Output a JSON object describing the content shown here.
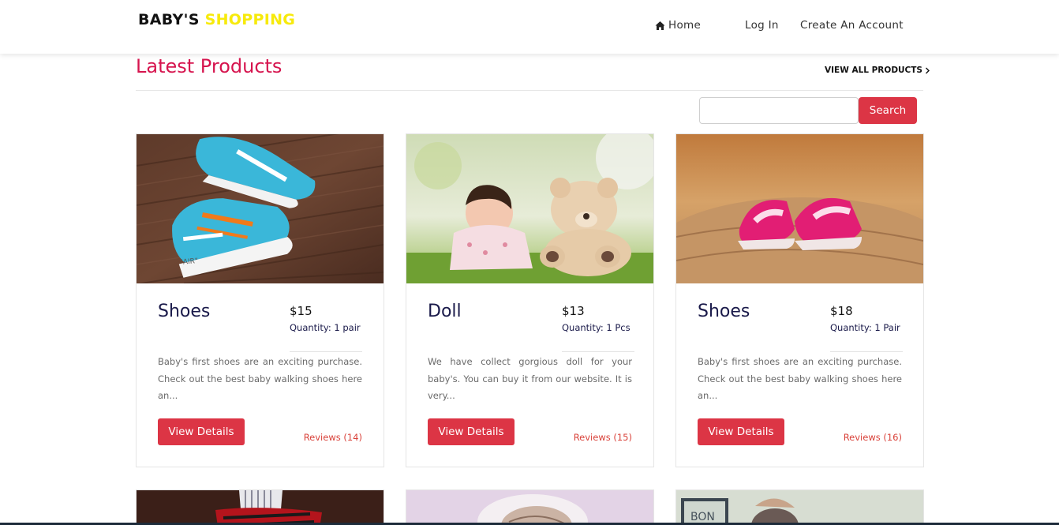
{
  "brand": {
    "part1": "BABY'S",
    "part2": "SHOPPING"
  },
  "nav": {
    "home": "Home",
    "login": "Log In",
    "create": "Create An Account"
  },
  "section": {
    "title": "Latest Products",
    "view_all": "VIEW ALL PRODUCTS"
  },
  "search": {
    "button": "Search",
    "value": ""
  },
  "products": [
    {
      "name": "Shoes",
      "price": "$15",
      "quantity": "Quantity: 1 pair",
      "description": "Baby's first shoes are an exciting purchase. Check out the best baby walking shoes here an...",
      "button": "View Details",
      "reviews": "Reviews (14)"
    },
    {
      "name": "Doll",
      "price": "$13",
      "quantity": "Quantity: 1 Pcs",
      "description": "We have collect gorgious doll for your baby's. You can buy it from our website. It is very...",
      "button": "View Details",
      "reviews": "Reviews (15)"
    },
    {
      "name": "Shoes",
      "price": "$18",
      "quantity": "Quantity: 1 Pair",
      "description": "Baby's first shoes are an exciting purchase. Check out the best baby walking shoes here an...",
      "button": "View Details",
      "reviews": "Reviews (16)"
    }
  ],
  "colors": {
    "accent": "#dc3545",
    "title": "#d6144e",
    "brand_yellow": "#f7ea0c",
    "reviews": "#d9423a"
  },
  "icons": {
    "home": "home-icon",
    "chevron": "chevron-right-icon"
  }
}
